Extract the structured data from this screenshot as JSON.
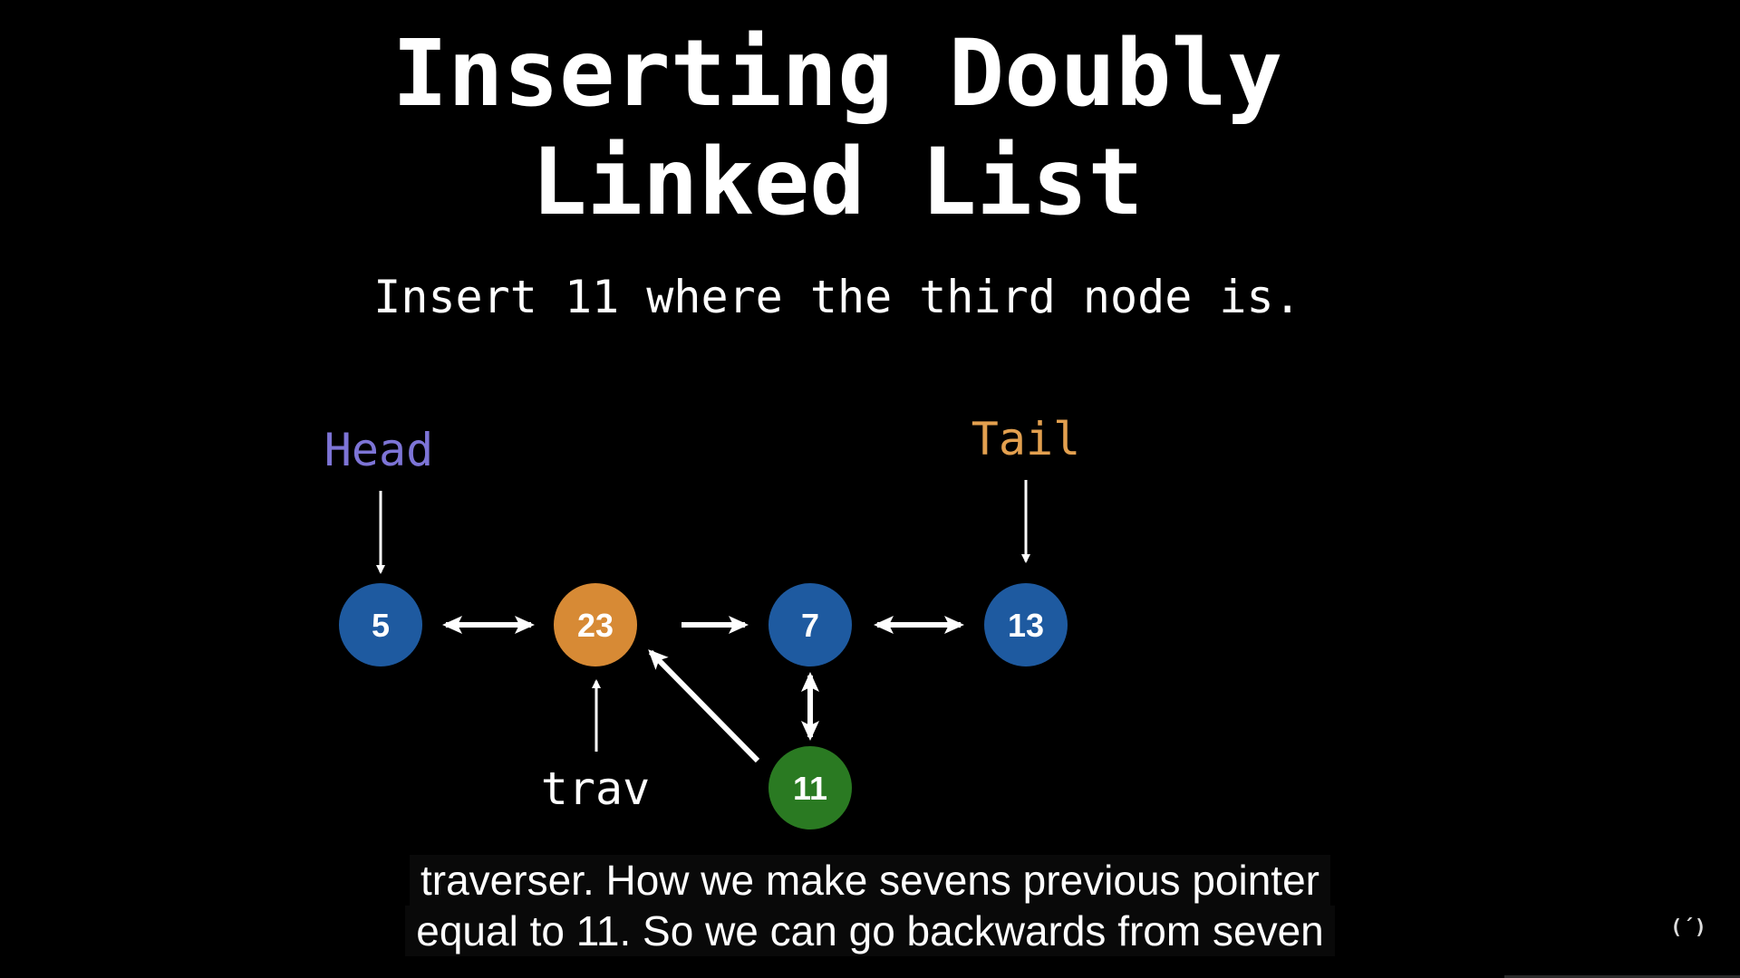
{
  "title": {
    "line1": "Inserting Doubly",
    "line2": "Linked List"
  },
  "subtitle": "Insert 11 where the third node is.",
  "diagram": {
    "head_label": "Head",
    "tail_label": "Tail",
    "trav_label": "trav",
    "colors": {
      "head_label": "#7d74d6",
      "tail_label": "#e3a04f",
      "node_blue": "#1e5aa0",
      "node_orange": "#d78a35",
      "node_green": "#2a7a22",
      "arrow": "#ffffff"
    },
    "nodes": [
      {
        "id": "n5",
        "value": "5",
        "color": "blue"
      },
      {
        "id": "n23",
        "value": "23",
        "color": "orange"
      },
      {
        "id": "n7",
        "value": "7",
        "color": "blue"
      },
      {
        "id": "n13",
        "value": "13",
        "color": "blue"
      },
      {
        "id": "n11",
        "value": "11",
        "color": "green"
      }
    ]
  },
  "captions": [
    "traverser. How we make sevens previous pointer",
    "equal to 11. So we can go backwards from seven"
  ],
  "logo": {
    "icon": "freecodecamp-logo-icon",
    "glyph": "(´)"
  }
}
